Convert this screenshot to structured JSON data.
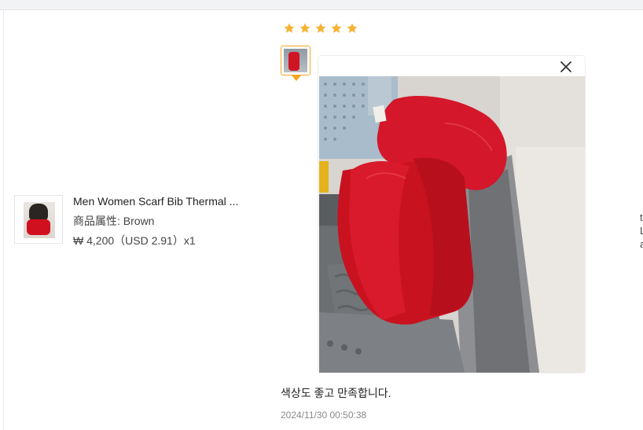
{
  "product": {
    "title": "Men Women Scarf Bib Thermal ...",
    "attribute": "商品属性:  Brown",
    "price": "₩ 4,200（USD  2.91）x1"
  },
  "review": {
    "rating": 5,
    "rating_max": 5,
    "text": "색상도 좋고 만족합니다.",
    "timestamp": "2024/11/30 00:50:38"
  },
  "edge_text": {
    "line1": "t",
    "line2": "L",
    "line3": "a"
  },
  "colors": {
    "star": "#f5b335",
    "accent": "#f5a623",
    "scarf_red": "#d0131f"
  },
  "icons": {
    "close": "close-icon",
    "star": "star-icon"
  }
}
